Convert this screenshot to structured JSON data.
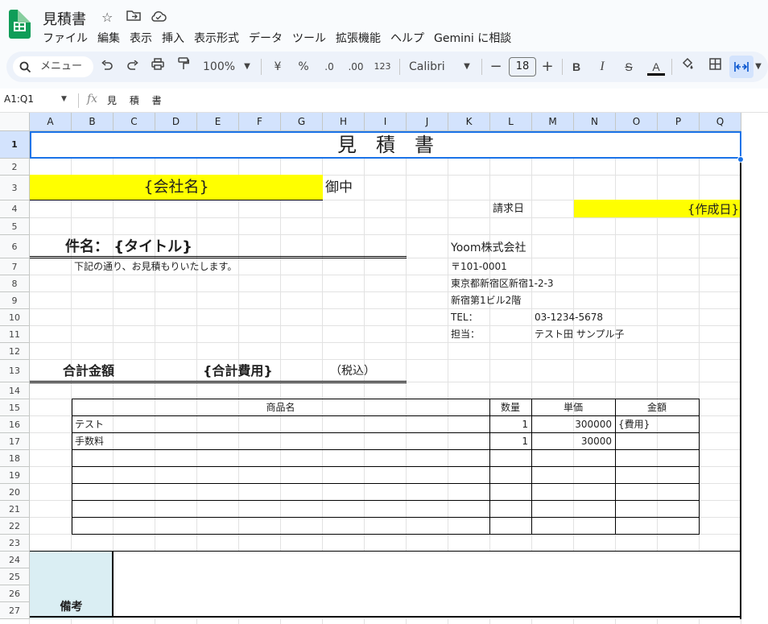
{
  "app": {
    "doc_title": "見積書",
    "menu": [
      "ファイル",
      "編集",
      "表示",
      "挿入",
      "表示形式",
      "データ",
      "ツール",
      "拡張機能",
      "ヘルプ",
      "Gemini に相談"
    ]
  },
  "toolbar": {
    "search_placeholder": "メニュー",
    "zoom": "100%",
    "currency": "¥",
    "percent": "%",
    "dec_decrease": ".0",
    "dec_increase": ".00",
    "number_format": "123",
    "font": "Calibri",
    "font_size": "18",
    "bold": "B",
    "italic": "I",
    "strike": "S",
    "text_color": "A"
  },
  "formula_bar": {
    "name_box": "A1:Q1",
    "fx": "fx",
    "value": "見 積 書"
  },
  "columns": [
    "A",
    "B",
    "C",
    "D",
    "E",
    "F",
    "G",
    "H",
    "I",
    "J",
    "K",
    "L",
    "M",
    "N",
    "O",
    "P",
    "Q"
  ],
  "rows": [
    "1",
    "2",
    "3",
    "4",
    "5",
    "6",
    "7",
    "8",
    "9",
    "10",
    "11",
    "12",
    "13",
    "14",
    "15",
    "16",
    "17",
    "18",
    "19",
    "20",
    "21",
    "22",
    "23",
    "24",
    "25",
    "26",
    "27"
  ],
  "sheet": {
    "title": "見　積　書",
    "company_placeholder": "{会社名}",
    "onchu": "御中",
    "date_label": "請求日",
    "date_placeholder": "{作成日}",
    "subject": "件名： {タイトル}",
    "intro": "下記の通り、お見積もりいたします。",
    "issuer_name": "Yoom株式会社",
    "postal": "〒101-0001",
    "address1": "東京都新宿区新宿1-2-3",
    "address2": "新宿第1ビル2階",
    "tel_label": "TEL：",
    "tel": "03-1234-5678",
    "contact_label": "担当：",
    "contact": "テスト田 サンプル子",
    "total_label": "合計金額",
    "total_placeholder": "{合計費用}",
    "tax_note": "（税込）",
    "table_headers": [
      "商品名",
      "数量",
      "単価",
      "金額"
    ],
    "items": [
      {
        "name": "テスト",
        "qty": "1",
        "price": "300000",
        "amount": "{費用}"
      },
      {
        "name": "手数料",
        "qty": "1",
        "price": "30000",
        "amount": ""
      }
    ],
    "remarks_label": "備考"
  },
  "colors": {
    "highlight": "#ffff00",
    "remarks_bg": "#daeef3",
    "selection": "#1a73e8",
    "header_selected": "#d3e3fd"
  }
}
